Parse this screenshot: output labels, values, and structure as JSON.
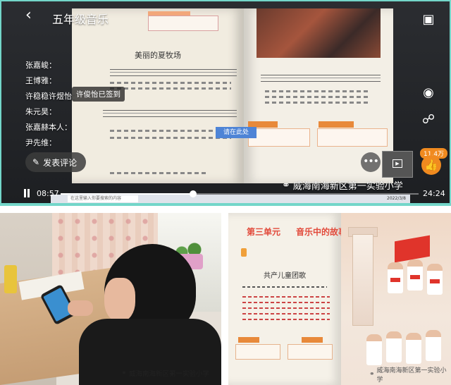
{
  "header": {
    "title": "五年级音乐",
    "back_icon": "back-arrow-icon"
  },
  "textbook_top": {
    "song_title": "美丽的夏牧场"
  },
  "attendance": {
    "names": [
      "张嘉峻：",
      "王博雅：",
      "许稳稳许煜怡：",
      "朱元昊：",
      "张嘉赫本人：",
      "尹先维："
    ],
    "checkin_message": "许俊怡已签到"
  },
  "floating_chip": "请在此处",
  "comment": {
    "label": "发表评论",
    "icon": "comment-icon"
  },
  "side_controls": [
    "screen-share-icon",
    "camera-icon",
    "unlock-icon"
  ],
  "like": {
    "count": "11.4万",
    "icon": "thumbs-up-icon"
  },
  "more_icon": "more-icon",
  "watermark_top": "威海南海新区第一实验小学",
  "player": {
    "current_time": "08:57",
    "total_time": "24:24",
    "progress": 0.37
  },
  "taskbar": {
    "search_placeholder": "在这里输入你要搜索的内容",
    "clock": "2022/3/8"
  },
  "photo_watermark": "威海南海新区第一实验小学",
  "textbook_bottom": {
    "unit_title": "第三单元",
    "unit_subtitle": "音乐中的故事",
    "song_title": "共产儿童团歌"
  },
  "book_watermark": "威海南海新区第一实验小学",
  "colors": {
    "frame": "#73d6c9",
    "accent_red": "#e24a3b",
    "like_orange": "#f08a1f"
  }
}
